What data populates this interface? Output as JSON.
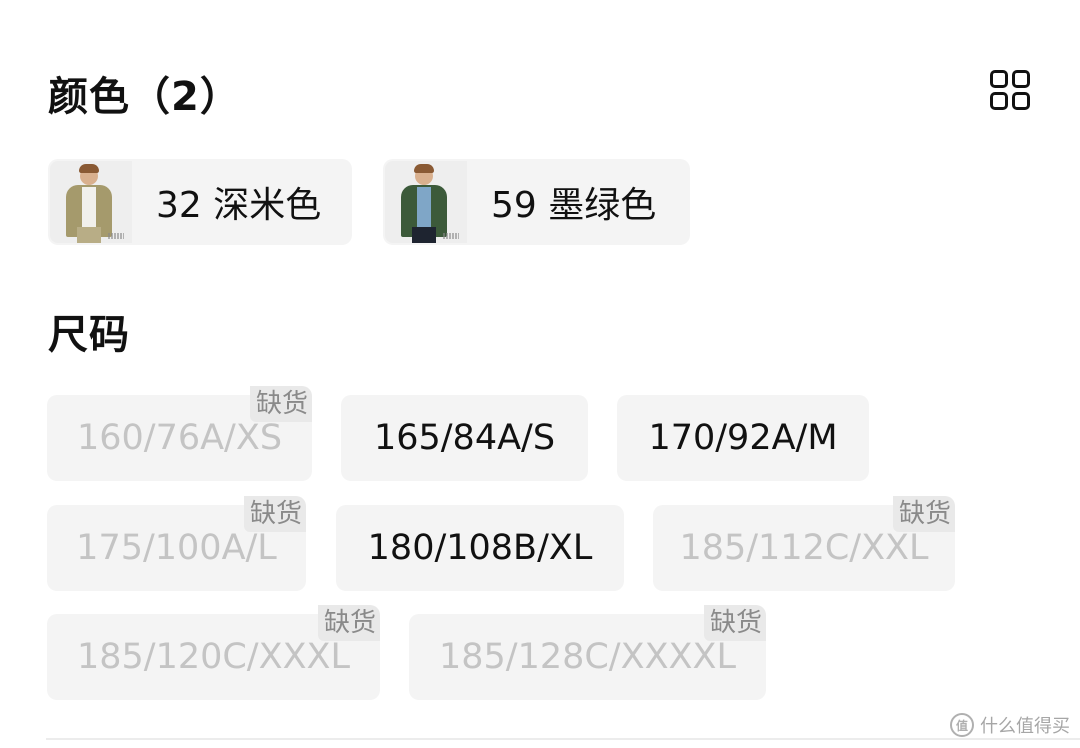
{
  "color_section": {
    "title": "颜色（2）",
    "view_toggle_icon": "grid-view-icon",
    "chips": [
      {
        "label": "32 深米色",
        "thumb_color": "#a59a6c"
      },
      {
        "label": "59 墨绿色",
        "thumb_color": "#3c5a3a"
      }
    ]
  },
  "size_section": {
    "title": "尺码",
    "sizes": [
      {
        "label": "160/76A/XS",
        "badge": "缺货",
        "available": false
      },
      {
        "label": "165/84A/S",
        "available": true
      },
      {
        "label": "170/92A/M",
        "available": true
      },
      {
        "label": "175/100A/L",
        "badge": "缺货",
        "available": false
      },
      {
        "label": "180/108B/XL",
        "available": true
      },
      {
        "label": "185/112C/XXL",
        "badge": "缺货",
        "available": false
      },
      {
        "label": "185/120C/XXXL",
        "badge": "缺货",
        "available": false
      },
      {
        "label": "185/128C/XXXXL",
        "badge": "缺货",
        "available": false
      }
    ]
  },
  "watermark": {
    "logo": "值",
    "text": "什么值得买"
  },
  "colors": {
    "text": "#111111",
    "disabled_text": "#c4c4c4",
    "chip_bg": "#f4f4f4",
    "badge_bg": "#e9e9e9",
    "badge_text": "#8a8a8a"
  }
}
